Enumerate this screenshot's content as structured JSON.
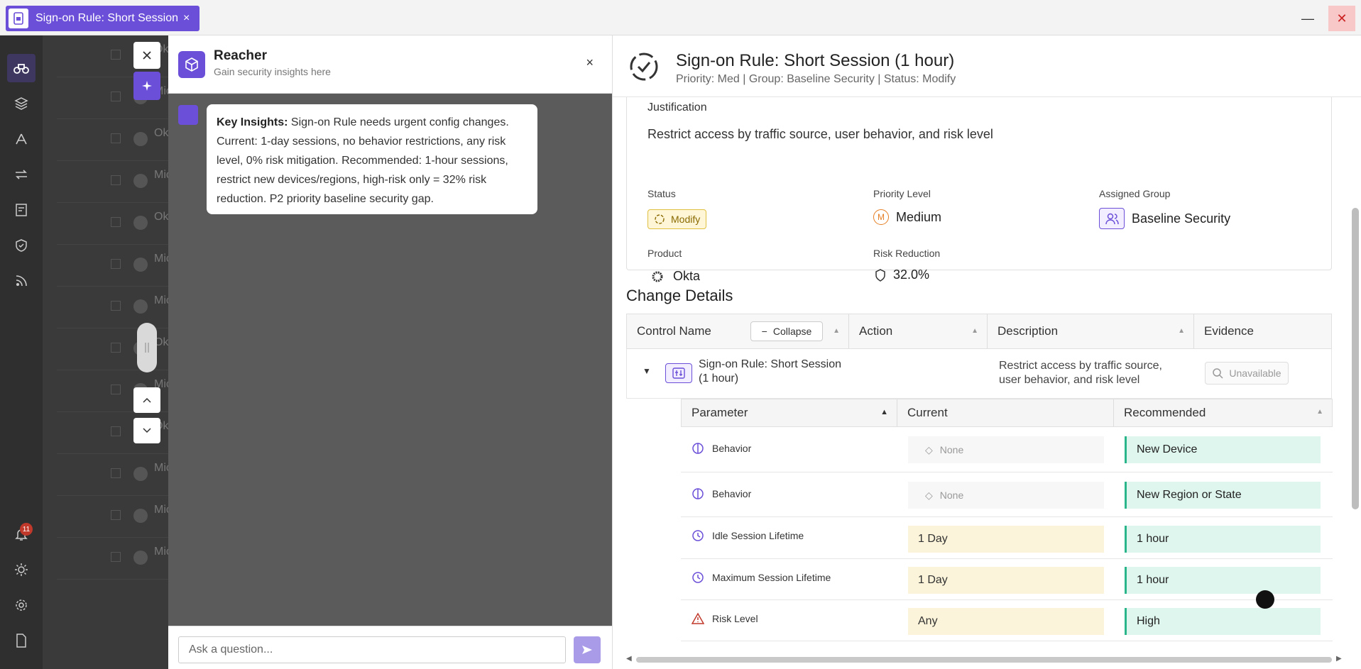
{
  "window": {
    "tab_title": "Sign-on Rule: Short Session",
    "tab_close": "×",
    "minimize": "—",
    "close": "✕"
  },
  "nav": {
    "notification_count": "11"
  },
  "background_list": {
    "rows": [
      "Okta",
      "Micro Cond",
      "Okta",
      "Micro Cond",
      "Okta",
      "Micro Cond",
      "Micro Cond",
      "Okta",
      "Micro Cond",
      "Okta",
      "Micro Cond",
      "Micro Endp",
      "Micro Cond"
    ]
  },
  "reacher": {
    "title": "Reacher",
    "subtitle": "Gain security insights here",
    "close": "×",
    "message_label": "Key Insights:",
    "message_text": "Sign-on Rule needs urgent config changes. Current: 1-day sessions, no behavior restrictions, any risk level, 0% risk mitigation. Recommended: 1-hour sessions, restrict new devices/regions, high-risk only = 32% risk reduction. P2 priority baseline security gap.",
    "ask_placeholder": "Ask a question..."
  },
  "details": {
    "title": "Sign-on Rule: Short Session (1 hour)",
    "subtitle": "Priority: Med | Group: Baseline Security | Status: Modify",
    "justification_label": "Justification",
    "justification_value": "Restrict access by traffic source, user behavior, and risk level",
    "status_label": "Status",
    "status_value": "Modify",
    "priority_label": "Priority Level",
    "priority_letter": "M",
    "priority_value": "Medium",
    "group_label": "Assigned Group",
    "group_value": "Baseline Security",
    "product_label": "Product",
    "product_value": "Okta",
    "risk_label": "Risk Reduction",
    "risk_value": "32.0%"
  },
  "change_details": {
    "title": "Change Details",
    "headers": {
      "control_name": "Control Name",
      "collapse": "Collapse",
      "action": "Action",
      "description": "Description",
      "evidence": "Evidence"
    },
    "row": {
      "name": "Sign-on Rule: Short Session (1 hour)",
      "description": "Restrict access by traffic source, user behavior, and risk level",
      "evidence": "Unavailable"
    },
    "param_headers": {
      "parameter": "Parameter",
      "current": "Current",
      "recommended": "Recommended"
    },
    "params": [
      {
        "name": "Behavior",
        "current": "None",
        "recommended": "New Device"
      },
      {
        "name": "Behavior",
        "current": "None",
        "recommended": "New Region or State"
      },
      {
        "name": "Idle Session Lifetime",
        "current": "1 Day",
        "recommended": "1 hour"
      },
      {
        "name": "Maximum Session Lifetime",
        "current": "1 Day",
        "recommended": "1 hour"
      },
      {
        "name": "Risk Level",
        "current": "Any",
        "recommended": "High"
      }
    ]
  },
  "colors": {
    "brand": "#6b4fd8",
    "recommended_bg": "#dff6ee",
    "current_warn_bg": "#fbf4da"
  }
}
